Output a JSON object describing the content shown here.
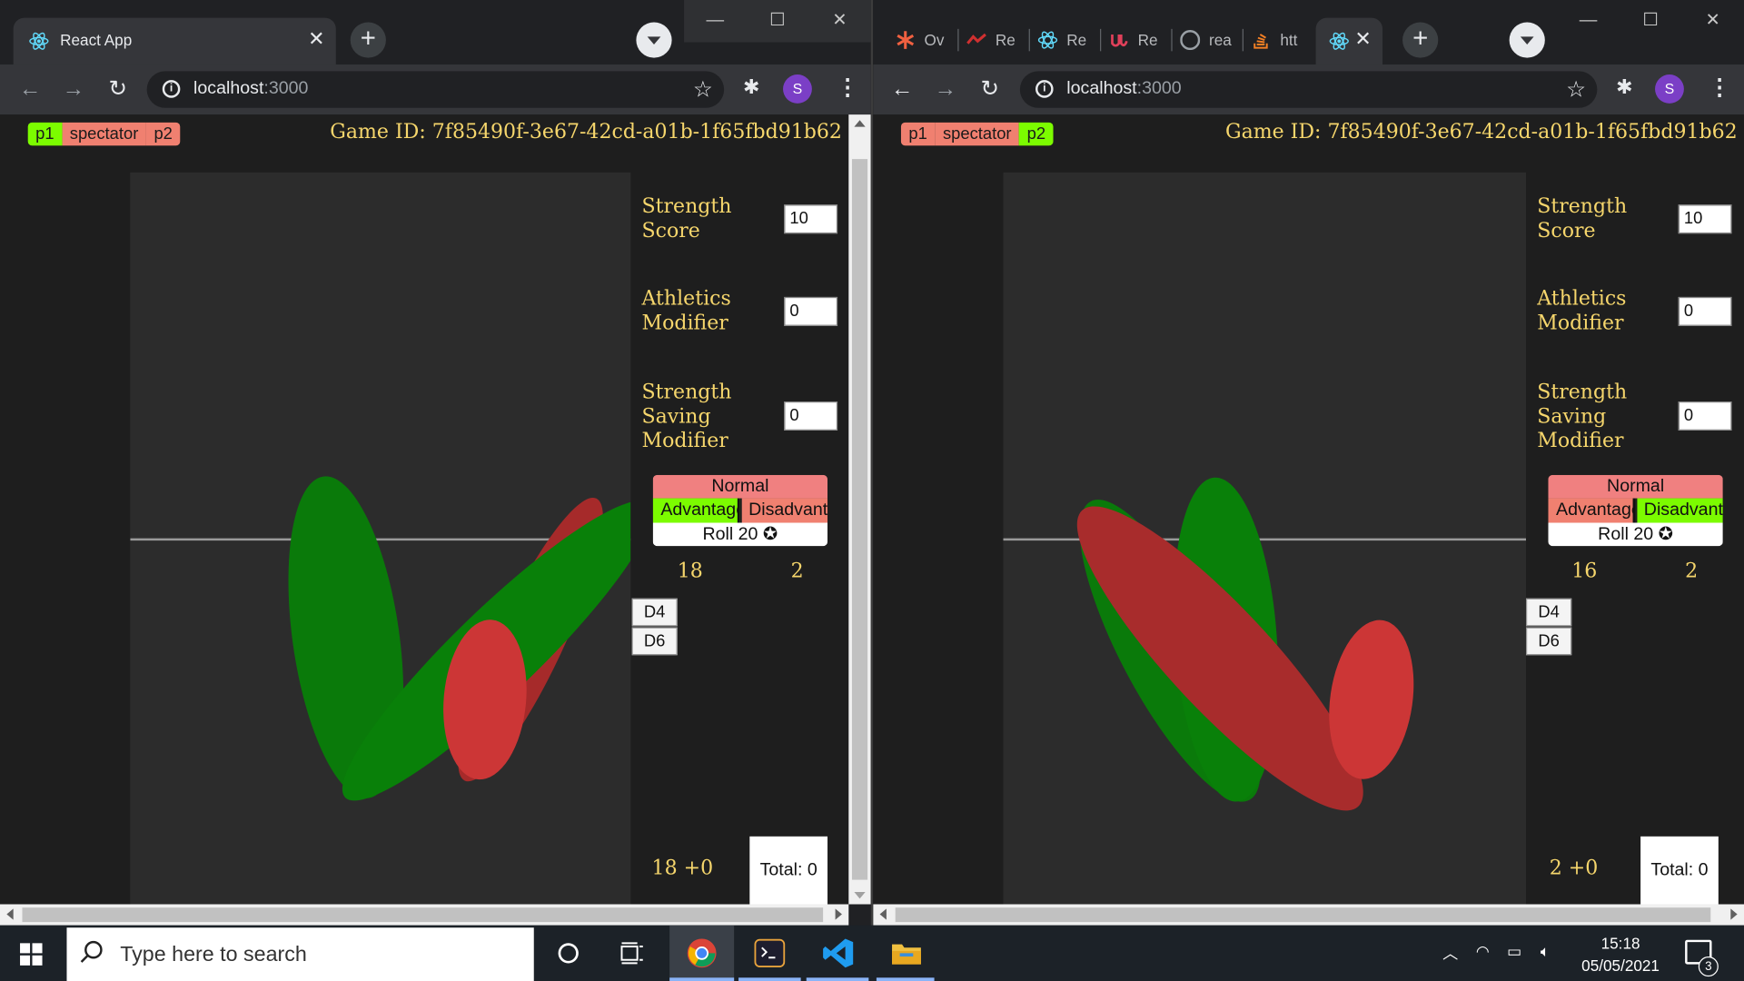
{
  "browser": {
    "tab_title": "React App",
    "url_host": "localhost",
    "url_port": ":3000",
    "avatar_letter": "S",
    "right_tabs": [
      "Ov",
      "Re",
      "Re",
      "Re",
      "rea",
      "htt"
    ]
  },
  "game": {
    "game_id_label": "Game ID: 7f85490f-3e67-42cd-a01b-1f65fbd91b62",
    "roles": [
      "p1",
      "spectator",
      "p2"
    ],
    "fields": {
      "strength_label_1": "Strength",
      "strength_label_2": "Score",
      "athletics_label_1": "Athletics",
      "athletics_label_2": "Modifier",
      "saving_label_1": "Strength",
      "saving_label_2": "Saving",
      "saving_label_3": "Modifier"
    },
    "roll": {
      "normal": "Normal",
      "advantage": "Advantage",
      "disadvantage": "Disadvantage",
      "roll_label": "Roll 20"
    },
    "d4": "D4",
    "d6": "D6",
    "total_label": "Total: 0"
  },
  "left": {
    "strength": "10",
    "athletics": "0",
    "saving": "0",
    "die_a": "18",
    "die_b": "2",
    "sum": "18 +0",
    "active_role": "p1"
  },
  "right": {
    "strength": "10",
    "athletics": "0",
    "saving": "0",
    "die_a": "16",
    "die_b": "2",
    "sum": "2 +0",
    "active_role": "p2"
  },
  "taskbar": {
    "search_placeholder": "Type here to search",
    "time": "15:18",
    "date": "05/05/2021",
    "notifications": "3"
  },
  "colors": {
    "accent_text": "#f6d66c",
    "green": "#7cfc00",
    "red_role": "#f08070",
    "piece_green": "#0a7a0a",
    "piece_red": "#b03030"
  }
}
